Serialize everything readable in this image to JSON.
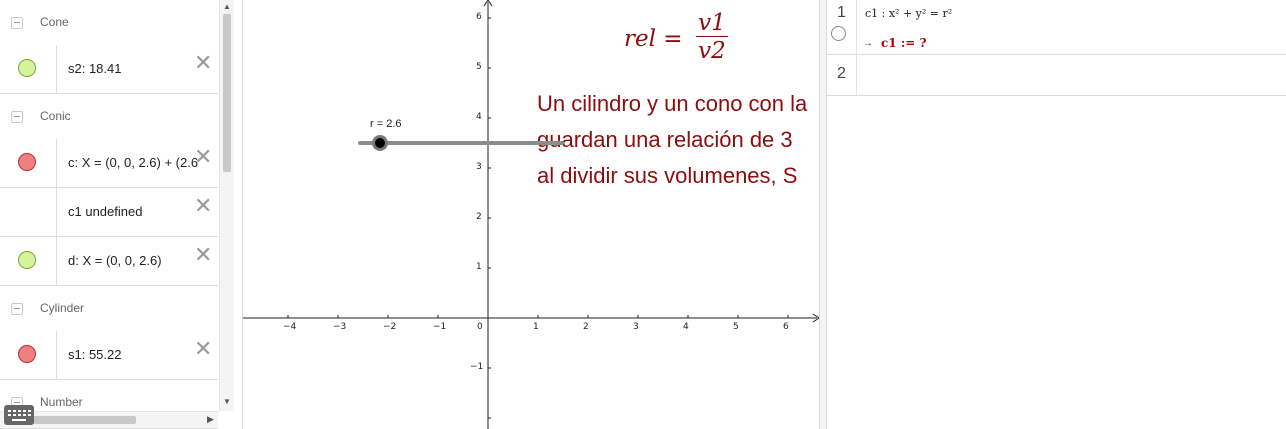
{
  "algebra": {
    "groups": {
      "cone": "Cone",
      "conic": "Conic",
      "cylinder": "Cylinder",
      "number": "Number"
    },
    "items": {
      "s2": "s2: 18.41",
      "c": "c: X = (0, 0, 2.6) + (2.6",
      "c1": "c1 undefined",
      "d": "d: X = (0, 0, 2.6)",
      "s1": "s1: 55.22"
    },
    "colors": {
      "visible_green": "#d5f29c",
      "visible_red": "#f08080"
    }
  },
  "graphics": {
    "formula": {
      "lhs": "rel =",
      "numerator": "v1",
      "denominator": "v2"
    },
    "text_lines": [
      "Un cilindro y un cono con la",
      "guardan una relación de 3",
      "al dividir sus volumenes, S"
    ],
    "slider": {
      "label": "r = 2.6",
      "value": 2.6
    },
    "x_ticks": [
      "−4",
      "−3",
      "−2",
      "−1",
      "0",
      "1",
      "2",
      "3",
      "4",
      "5",
      "6"
    ],
    "y_ticks": [
      "6",
      "5",
      "4",
      "3",
      "2",
      "1",
      "−1"
    ],
    "text_color": "#8b0d0d"
  },
  "cas": {
    "rows": [
      {
        "number": "1",
        "input": "c1 : x² + y² = r²",
        "arrow": "→",
        "output": "c1 := ?"
      },
      {
        "number": "2",
        "input": ""
      }
    ]
  }
}
